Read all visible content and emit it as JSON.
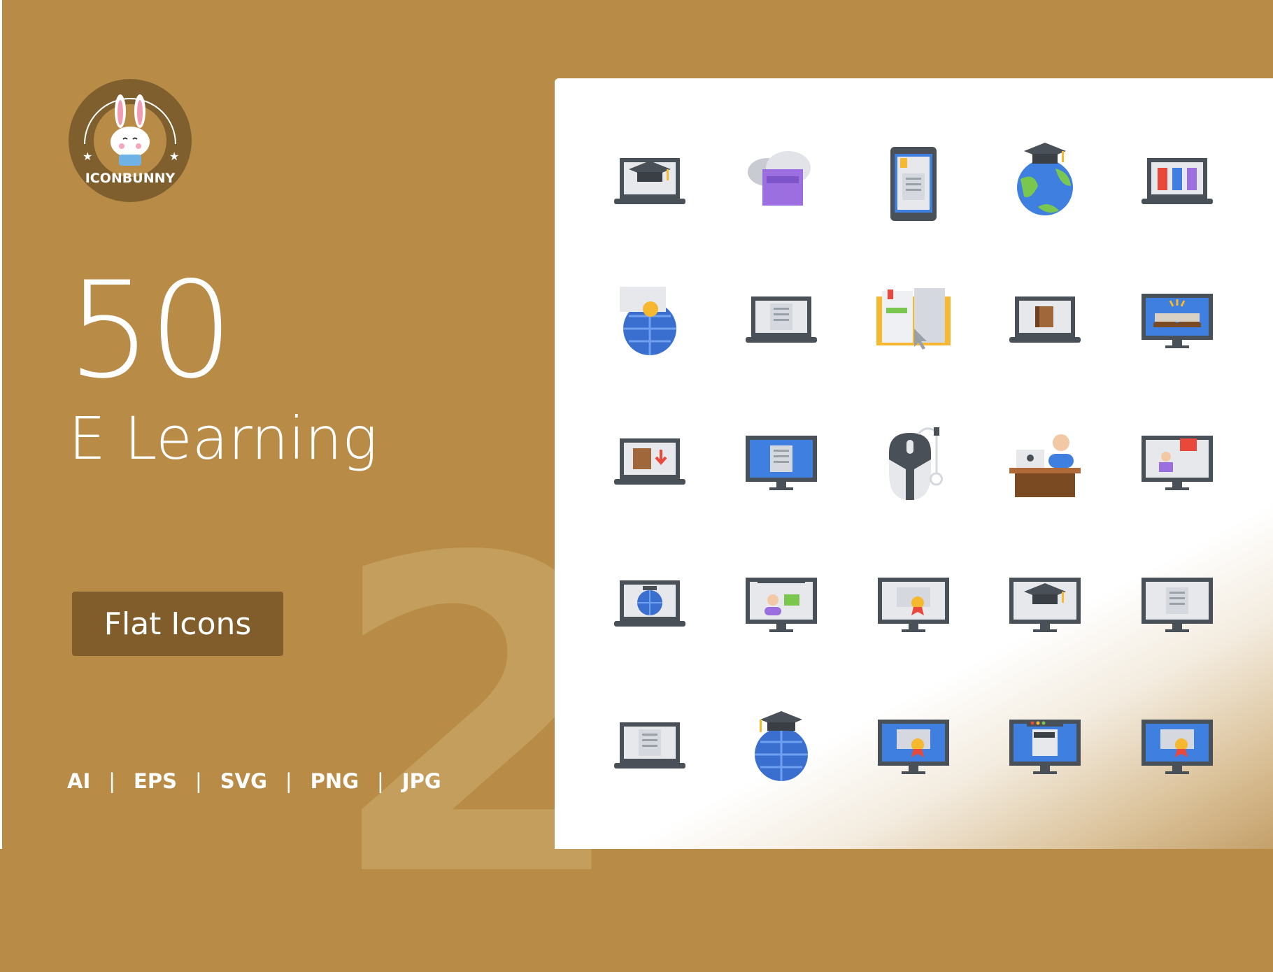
{
  "brand": {
    "logo_text": "ICONBUNNY"
  },
  "hero": {
    "count": "50",
    "title": "E Learning",
    "style_button": "Flat Icons",
    "watermark_number": "2"
  },
  "formats": [
    "AI",
    "EPS",
    "SVG",
    "PNG",
    "JPG"
  ],
  "colors": {
    "background": "#b88b47",
    "button": "#805d2b",
    "card": "#ffffff",
    "accent_blue": "#3f7fe0",
    "dark": "#4a5058"
  },
  "icons": [
    {
      "name": "laptop-graduation-cap-icon",
      "base": "laptop",
      "deco": "cap"
    },
    {
      "name": "cloud-document-icon",
      "base": "cloud",
      "deco": "none"
    },
    {
      "name": "tablet-ebook-icon",
      "base": "tablet",
      "deco": "none"
    },
    {
      "name": "globe-graduation-cap-icon",
      "base": "globe-earth",
      "deco": "cap"
    },
    {
      "name": "laptop-library-icon",
      "base": "laptop",
      "deco": "books"
    },
    {
      "name": "globe-certificate-icon",
      "base": "globe",
      "deco": "cert"
    },
    {
      "name": "laptop-document-slides-icon",
      "base": "laptop",
      "deco": "doc"
    },
    {
      "name": "open-book-cursor-icon",
      "base": "book",
      "deco": "none"
    },
    {
      "name": "laptop-book-slides-icon",
      "base": "laptop",
      "deco": "book"
    },
    {
      "name": "monitor-open-book-icon",
      "base": "monitor-blue",
      "deco": "openbook"
    },
    {
      "name": "laptop-book-download-icon",
      "base": "laptop",
      "deco": "download"
    },
    {
      "name": "monitor-checklist-icon",
      "base": "monitor-blue",
      "deco": "doc"
    },
    {
      "name": "computer-mouse-icon",
      "base": "mouse",
      "deco": "none"
    },
    {
      "name": "teacher-desk-icon",
      "base": "desk",
      "deco": "none"
    },
    {
      "name": "monitor-video-lecture-icon",
      "base": "monitor",
      "deco": "people"
    },
    {
      "name": "laptop-globe-cap-icon",
      "base": "laptop",
      "deco": "globe"
    },
    {
      "name": "monitor-video-chat-icon",
      "base": "monitor",
      "deco": "person"
    },
    {
      "name": "monitor-certificate-icon",
      "base": "monitor",
      "deco": "cert"
    },
    {
      "name": "monitor-graduation-cap-icon",
      "base": "monitor",
      "deco": "cap"
    },
    {
      "name": "monitor-newspaper-icon",
      "base": "monitor",
      "deco": "doc"
    },
    {
      "name": "laptop-document-icon",
      "base": "laptop",
      "deco": "doc"
    },
    {
      "name": "globe-grid-cap-icon",
      "base": "globe",
      "deco": "cap"
    },
    {
      "name": "monitor-diploma-icon",
      "base": "monitor-blue",
      "deco": "cert"
    },
    {
      "name": "monitor-browser-cap-icon",
      "base": "monitor-blue",
      "deco": "browser"
    },
    {
      "name": "monitor-award-icon",
      "base": "monitor-blue",
      "deco": "cert"
    }
  ]
}
